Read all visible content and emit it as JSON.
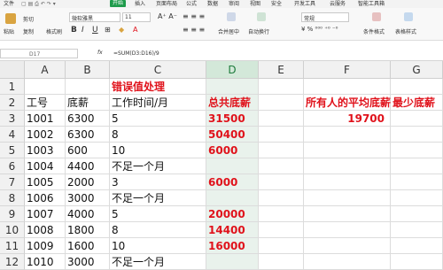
{
  "menu": {
    "file": "文件",
    "start": "开始",
    "items": [
      "插入",
      "页面布局",
      "公式",
      "数据",
      "审阅",
      "视图",
      "安全",
      "开发工具",
      "云服务",
      "智能工具箱"
    ]
  },
  "ribbon": {
    "paste": "粘贴",
    "cut": "剪切",
    "copy": "复制",
    "format_painter": "格式刷",
    "font_name": "微软雅黑",
    "font_size": "11",
    "merge_center": "合并居中",
    "wrap_text": "自动换行",
    "number_format": "常规",
    "conditional_format": "条件格式",
    "table_style": "表格样式"
  },
  "formula_bar": {
    "name_box": "D17",
    "fx": "fx",
    "formula": "=SUM(D3:D16)/9"
  },
  "columns": [
    "A",
    "B",
    "C",
    "D",
    "E",
    "F",
    "G"
  ],
  "selected_column": "D",
  "rows": [
    "1",
    "2",
    "3",
    "4",
    "5",
    "6",
    "7",
    "8",
    "9",
    "10",
    "11",
    "12"
  ],
  "cells": {
    "C1": "错误值处理",
    "A2": "工号",
    "B2": "底薪",
    "C2": "工作时间/月",
    "D2": "总共底薪",
    "F2": "所有人的平均底薪",
    "G2": "最少底薪",
    "A3": "1001",
    "B3": "6300",
    "C3": "5",
    "D3": "31500",
    "F3": "19700",
    "A4": "1002",
    "B4": "6300",
    "C4": "8",
    "D4": "50400",
    "A5": "1003",
    "B5": "600",
    "C5": "10",
    "D5": "6000",
    "A6": "1004",
    "B6": "4400",
    "C6": "不足一个月",
    "A7": "1005",
    "B7": "2000",
    "C7": "3",
    "D7": "6000",
    "A8": "1006",
    "B8": "3000",
    "C8": "不足一个月",
    "A9": "1007",
    "B9": "4000",
    "C9": "5",
    "D9": "20000",
    "A10": "1008",
    "B10": "1800",
    "C10": "8",
    "D10": "14400",
    "A11": "1009",
    "B11": "1600",
    "C11": "10",
    "D11": "16000",
    "A12": "1010",
    "B12": "3000",
    "C12": "不足一个月"
  },
  "colors": {
    "accent_green": "#1e9b4b",
    "error_red": "#e0121b",
    "selected_column_bg": "#e9f2ec"
  }
}
